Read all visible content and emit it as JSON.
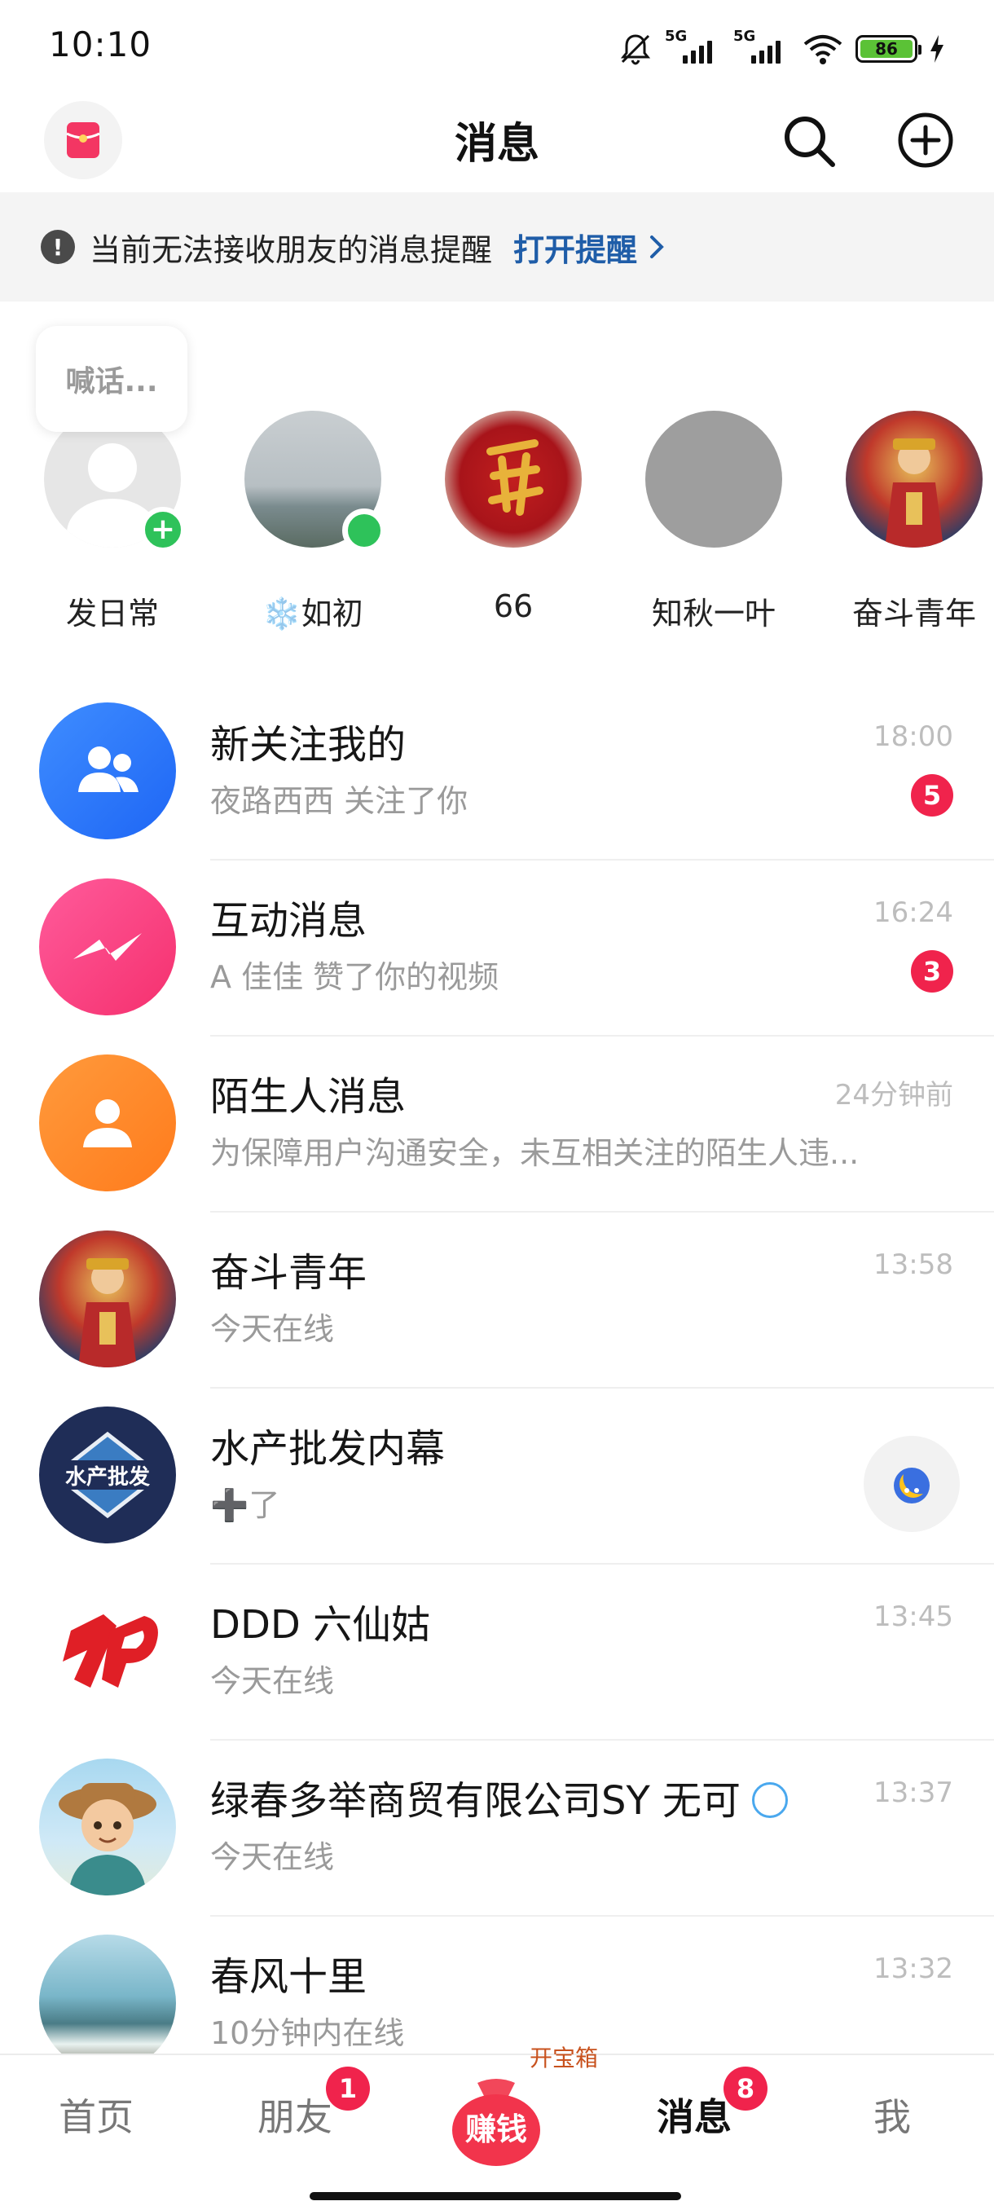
{
  "status_bar": {
    "time": "10:10",
    "net1": "5G",
    "net2": "5G",
    "battery": "86"
  },
  "header": {
    "title": "消息"
  },
  "notice": {
    "text": "当前无法接收朋友的消息提醒",
    "link": "打开提醒"
  },
  "stories": {
    "bubble": "喊话...",
    "items": [
      {
        "name": "发日常"
      },
      {
        "name": "❄️如初"
      },
      {
        "name": "66"
      },
      {
        "name": "知秋一叶"
      },
      {
        "name": "奋斗青年"
      }
    ]
  },
  "messages": [
    {
      "title": "新关注我的",
      "subtitle": "夜路西西 关注了你",
      "time": "18:00",
      "count": "5"
    },
    {
      "title": "互动消息",
      "subtitle": "A 佳佳 赞了你的视频",
      "time": "16:24",
      "count": "3"
    },
    {
      "title": "陌生人消息",
      "subtitle": "为保障用户沟通安全，未互相关注的陌生人违...",
      "time": "24分钟前"
    },
    {
      "title": "奋斗青年",
      "subtitle": "今天在线",
      "time": "13:58"
    },
    {
      "title": "水产批发内幕",
      "subtitle": "➕了",
      "avatar_text": "水产批发"
    },
    {
      "title": "DDD 六仙姑",
      "subtitle": "今天在线",
      "time": "13:45"
    },
    {
      "title": "绿春多举商贸有限公司SY 无可",
      "subtitle": "今天在线",
      "time": "13:37"
    },
    {
      "title": "春风十里",
      "subtitle": "10分钟内在线",
      "time": "13:32"
    }
  ],
  "bottom_nav": {
    "home": "首页",
    "friends": "朋友",
    "friends_badge": "1",
    "earn": "赚钱",
    "earn_tag": "开宝箱",
    "messages": "消息",
    "messages_badge": "8",
    "me": "我"
  }
}
